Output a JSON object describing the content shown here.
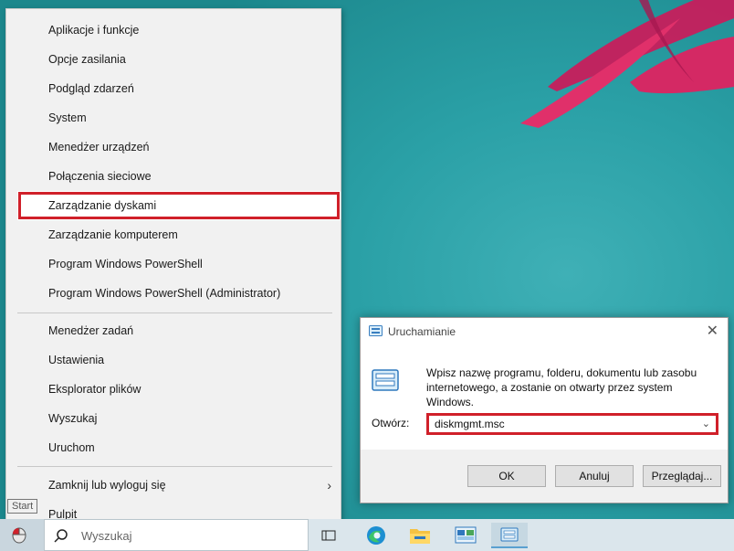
{
  "winx_menu": {
    "items": [
      {
        "label": "Aplikacje i funkcje"
      },
      {
        "label": "Opcje zasilania"
      },
      {
        "label": "Podgląd zdarzeń"
      },
      {
        "label": "System"
      },
      {
        "label": "Menedżer urządzeń"
      },
      {
        "label": "Połączenia sieciowe"
      },
      {
        "label": "Zarządzanie dyskami",
        "highlighted": true
      },
      {
        "label": "Zarządzanie komputerem"
      },
      {
        "label": "Program Windows PowerShell"
      },
      {
        "label": "Program Windows PowerShell (Administrator)"
      },
      {
        "label": "Menedżer zadań"
      },
      {
        "label": "Ustawienia"
      },
      {
        "label": "Eksplorator plików"
      },
      {
        "label": "Wyszukaj"
      },
      {
        "label": "Uruchom"
      },
      {
        "label": "Zamknij lub wyloguj się",
        "has_submenu": true
      },
      {
        "label": "Pulpit"
      }
    ],
    "submenu_arrow": "›"
  },
  "run_dialog": {
    "title": "Uruchamianie",
    "close_glyph": "✕",
    "description": "Wpisz nazwę programu, folderu, dokumentu lub zasobu internetowego, a zostanie on otwarty przez system Windows.",
    "open_label": "Otwórz:",
    "input_value": "diskmgmt.msc",
    "input_dropdown_glyph": "⌄",
    "ok_label": "OK",
    "cancel_label": "Anuluj",
    "browse_label": "Przeglądaj..."
  },
  "tooltip": {
    "text": "Start"
  },
  "taskbar": {
    "search_placeholder": "Wyszukaj",
    "icons": [
      "start-icon",
      "search-icon",
      "task-view-icon",
      "edge-icon",
      "file-explorer-icon",
      "control-panel-icon",
      "run-icon"
    ]
  },
  "colors": {
    "highlight_border": "#d0202a",
    "desktop_bg": "#2aa0a6",
    "petal": "#e0306a"
  }
}
